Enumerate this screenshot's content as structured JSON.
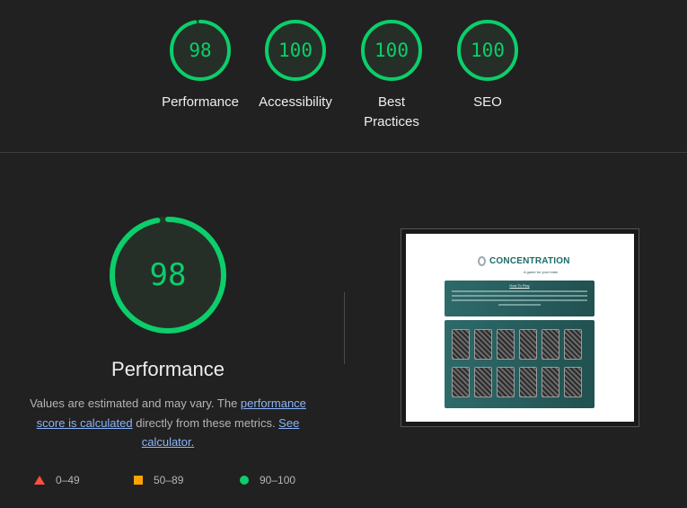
{
  "scores": [
    {
      "value": "98",
      "label": "Performance",
      "fraction": 0.98,
      "color": "#0cce6b"
    },
    {
      "value": "100",
      "label": "Accessibility",
      "fraction": 1.0,
      "color": "#0cce6b"
    },
    {
      "value": "100",
      "label": "Best Practices",
      "fraction": 1.0,
      "color": "#0cce6b"
    },
    {
      "value": "100",
      "label": "SEO",
      "fraction": 1.0,
      "color": "#0cce6b"
    }
  ],
  "performance": {
    "value": "98",
    "fraction": 0.98,
    "title": "Performance",
    "desc_part1": "Values are estimated and may vary. The ",
    "desc_link1": "performance score is calculated",
    "desc_part2": " directly from these metrics. ",
    "desc_link2": "See calculator."
  },
  "legend": [
    {
      "range": "0–49",
      "shape": "triangle",
      "color": "#ff4e42"
    },
    {
      "range": "50–89",
      "shape": "square",
      "color": "#ffa400"
    },
    {
      "range": "90–100",
      "shape": "circle",
      "color": "#0cce6b"
    }
  ],
  "screenshot": {
    "logo": "CONCENTRATION",
    "tagline": "A game for your brain",
    "how_to_play": "How To Play"
  }
}
